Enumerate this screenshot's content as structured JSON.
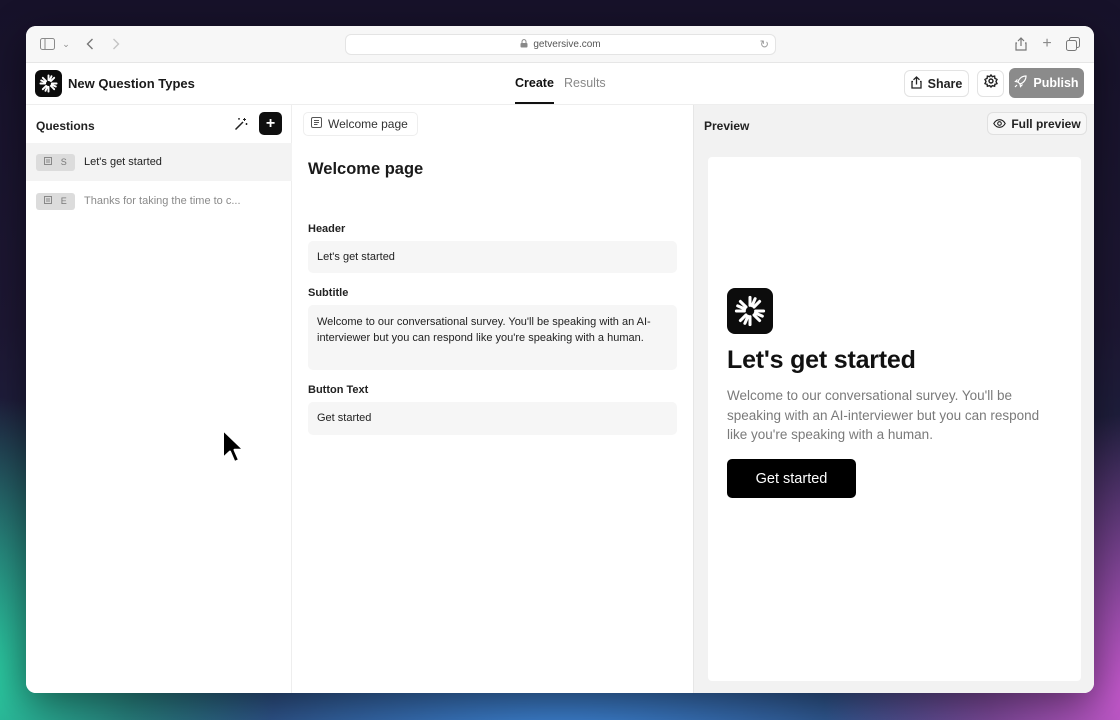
{
  "browser": {
    "url": "getversive.com"
  },
  "app": {
    "title": "New Question Types",
    "tabs": [
      {
        "label": "Create",
        "active": true
      },
      {
        "label": "Results",
        "active": false
      }
    ],
    "share_label": "Share",
    "publish_label": "Publish"
  },
  "questions": {
    "heading": "Questions",
    "items": [
      {
        "type_letter": "S",
        "label": "Let's get started",
        "selected": true
      },
      {
        "type_letter": "E",
        "label": "Thanks for taking the time to c...",
        "selected": false
      }
    ]
  },
  "editor": {
    "chip_label": "Welcome page",
    "title": "Welcome page",
    "fields": [
      {
        "label": "Header",
        "value": "Let's get started"
      },
      {
        "label": "Subtitle",
        "value": "Welcome to our conversational survey. You'll be speaking with an AI-interviewer but you can respond like you're speaking with a human."
      },
      {
        "label": "Button Text",
        "value": "Get started"
      }
    ]
  },
  "preview": {
    "heading": "Preview",
    "full_preview_label": "Full preview",
    "title": "Let's get started",
    "subtitle": "Welcome to our conversational survey. You'll be speaking with an AI-interviewer but you can respond like you're speaking with a human.",
    "button_label": "Get started"
  },
  "colors": {
    "accent": "#000000",
    "publish_bg": "#8b8b8b",
    "selected_row": "#f3f3f3",
    "preview_bg": "#f2f2f2"
  }
}
